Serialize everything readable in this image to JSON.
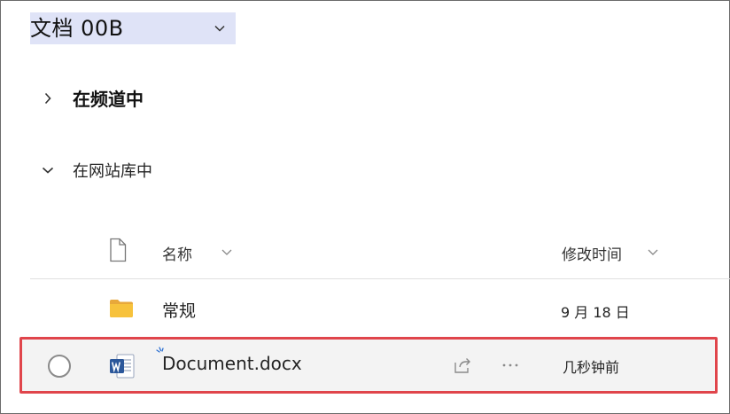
{
  "library": {
    "title": "文档 00B"
  },
  "sections": {
    "channel": {
      "label": "在频道中",
      "expanded": false
    },
    "site": {
      "label": "在网站库中",
      "expanded": true
    }
  },
  "columns": {
    "name": "名称",
    "modified": "修改时间"
  },
  "rows": [
    {
      "type": "folder",
      "name": "常规",
      "modified": "9 月 18 日",
      "icon": "folder-icon"
    },
    {
      "type": "word",
      "name": "Document.docx",
      "modified": "几秒钟前",
      "icon": "word-icon",
      "is_new": true,
      "highlighted": true
    }
  ],
  "colors": {
    "highlight_border": "#e0454b",
    "header_highlight": "#dfe3f7",
    "folder": "#f7c23c",
    "word_blue": "#2b579a"
  }
}
